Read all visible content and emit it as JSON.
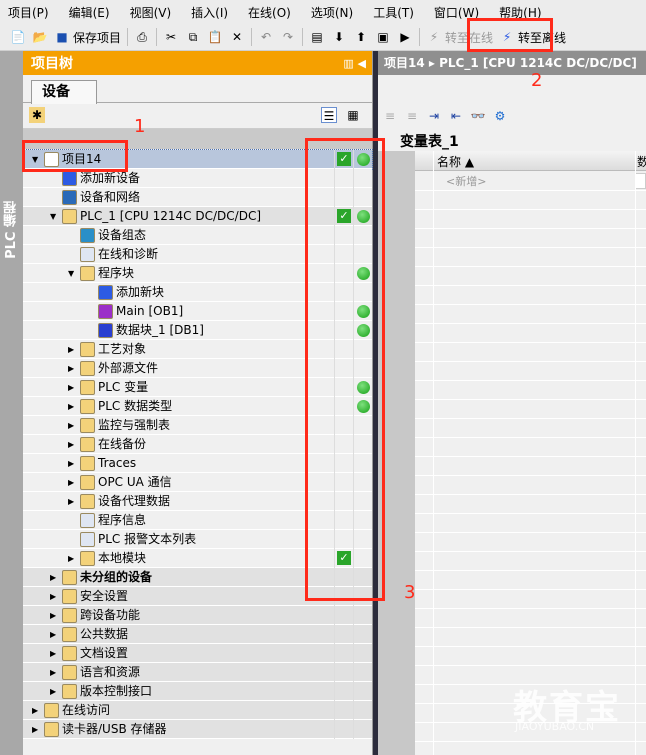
{
  "menu": [
    "项目(P)",
    "编辑(E)",
    "视图(V)",
    "插入(I)",
    "在线(O)",
    "选项(N)",
    "工具(T)",
    "窗口(W)",
    "帮助(H)"
  ],
  "toolbar": {
    "save_label": "保存项目",
    "go_online": "转至在线",
    "go_offline": "转至离线"
  },
  "side_strip": "PLC 编程",
  "tree": {
    "title": "项目树",
    "tab": "设备",
    "rows": [
      {
        "level": 0,
        "label": "项目14",
        "exp": "open",
        "check": true,
        "dot": true,
        "selected": true,
        "icon": "project-icon",
        "color": "#ffffff"
      },
      {
        "level": 1,
        "label": "添加新设备",
        "exp": "none",
        "icon": "add-device-icon",
        "color": "#2d5be3"
      },
      {
        "level": 1,
        "label": "设备和网络",
        "exp": "none",
        "icon": "network-icon",
        "color": "#2a6ab8"
      },
      {
        "level": 1,
        "label": "PLC_1 [CPU 1214C DC/DC/DC]",
        "exp": "open",
        "check": true,
        "dot": true,
        "shaded": true,
        "icon": "plc-icon",
        "color": "#f3d27a"
      },
      {
        "level": 2,
        "label": "设备组态",
        "exp": "none",
        "icon": "device-config-icon",
        "color": "#2a8fc8"
      },
      {
        "level": 2,
        "label": "在线和诊断",
        "exp": "none",
        "icon": "diagnostics-icon",
        "color": "#dfe6f2"
      },
      {
        "level": 2,
        "label": "程序块",
        "exp": "open",
        "dot": true,
        "icon": "folder-icon",
        "color": "#f3d27a"
      },
      {
        "level": 3,
        "label": "添加新块",
        "exp": "none",
        "icon": "add-block-icon",
        "color": "#2d5be3"
      },
      {
        "level": 3,
        "label": "Main [OB1]",
        "exp": "none",
        "dot": true,
        "icon": "ob-icon",
        "color": "#9b2fc8"
      },
      {
        "level": 3,
        "label": "数据块_1 [DB1]",
        "exp": "none",
        "dot": true,
        "icon": "db-icon",
        "color": "#2a3fd0"
      },
      {
        "level": 2,
        "label": "工艺对象",
        "exp": "closed",
        "icon": "folder-icon",
        "color": "#f3d27a"
      },
      {
        "level": 2,
        "label": "外部源文件",
        "exp": "closed",
        "icon": "folder-icon",
        "color": "#f3d27a"
      },
      {
        "level": 2,
        "label": "PLC 变量",
        "exp": "closed",
        "dot": true,
        "icon": "folder-icon",
        "color": "#f3d27a"
      },
      {
        "level": 2,
        "label": "PLC 数据类型",
        "exp": "closed",
        "dot": true,
        "icon": "folder-icon",
        "color": "#f3d27a"
      },
      {
        "level": 2,
        "label": "监控与强制表",
        "exp": "closed",
        "icon": "folder-icon",
        "color": "#f3d27a"
      },
      {
        "level": 2,
        "label": "在线备份",
        "exp": "closed",
        "icon": "folder-icon",
        "color": "#f3d27a"
      },
      {
        "level": 2,
        "label": "Traces",
        "exp": "closed",
        "icon": "folder-icon",
        "color": "#f3d27a"
      },
      {
        "level": 2,
        "label": "OPC UA 通信",
        "exp": "closed",
        "icon": "folder-icon",
        "color": "#f3d27a"
      },
      {
        "level": 2,
        "label": "设备代理数据",
        "exp": "closed",
        "icon": "folder-icon",
        "color": "#f3d27a"
      },
      {
        "level": 2,
        "label": "程序信息",
        "exp": "none",
        "icon": "program-info-icon",
        "color": "#dfe6f2"
      },
      {
        "level": 2,
        "label": "PLC 报警文本列表",
        "exp": "none",
        "icon": "text-list-icon",
        "color": "#dfe6f2"
      },
      {
        "level": 2,
        "label": "本地模块",
        "exp": "closed",
        "check": true,
        "icon": "folder-icon",
        "color": "#f3d27a"
      },
      {
        "level": 1,
        "label": "未分组的设备",
        "exp": "closed",
        "bold": true,
        "shaded": true,
        "icon": "folder-icon",
        "color": "#f3d27a"
      },
      {
        "level": 1,
        "label": "安全设置",
        "exp": "closed",
        "shaded": true,
        "icon": "folder-icon",
        "color": "#f3d27a"
      },
      {
        "level": 1,
        "label": "跨设备功能",
        "exp": "closed",
        "shaded": true,
        "icon": "folder-icon",
        "color": "#f3d27a"
      },
      {
        "level": 1,
        "label": "公共数据",
        "exp": "closed",
        "shaded": true,
        "icon": "folder-icon",
        "color": "#f3d27a"
      },
      {
        "level": 1,
        "label": "文档设置",
        "exp": "closed",
        "shaded": true,
        "icon": "folder-icon",
        "color": "#f3d27a"
      },
      {
        "level": 1,
        "label": "语言和资源",
        "exp": "closed",
        "shaded": true,
        "icon": "folder-icon",
        "color": "#f3d27a"
      },
      {
        "level": 1,
        "label": "版本控制接口",
        "exp": "closed",
        "shaded": true,
        "icon": "folder-icon",
        "color": "#f3d27a"
      },
      {
        "level": 0,
        "label": "在线访问",
        "exp": "closed",
        "shaded": true,
        "icon": "folder-icon",
        "color": "#f3d27a"
      },
      {
        "level": 0,
        "label": "读卡器/USB 存储器",
        "exp": "closed",
        "shaded": true,
        "icon": "folder-icon",
        "color": "#f3d27a"
      }
    ]
  },
  "editor": {
    "breadcrumb": [
      "项目14",
      "PLC_1 [CPU 1214C DC/DC/DC]"
    ],
    "table_title": "变量表_1",
    "col_name": "名称 ▲",
    "col_type": "数",
    "new_row": "<新增>"
  },
  "annotations": [
    "1",
    "2",
    "3"
  ],
  "watermark": {
    "text": "教育宝",
    "sub": "JIAOYUBAO.CN"
  },
  "colors": {
    "accent": "#f5a000",
    "annotation": "#ff2a1a",
    "status_ok": "#16a016"
  }
}
